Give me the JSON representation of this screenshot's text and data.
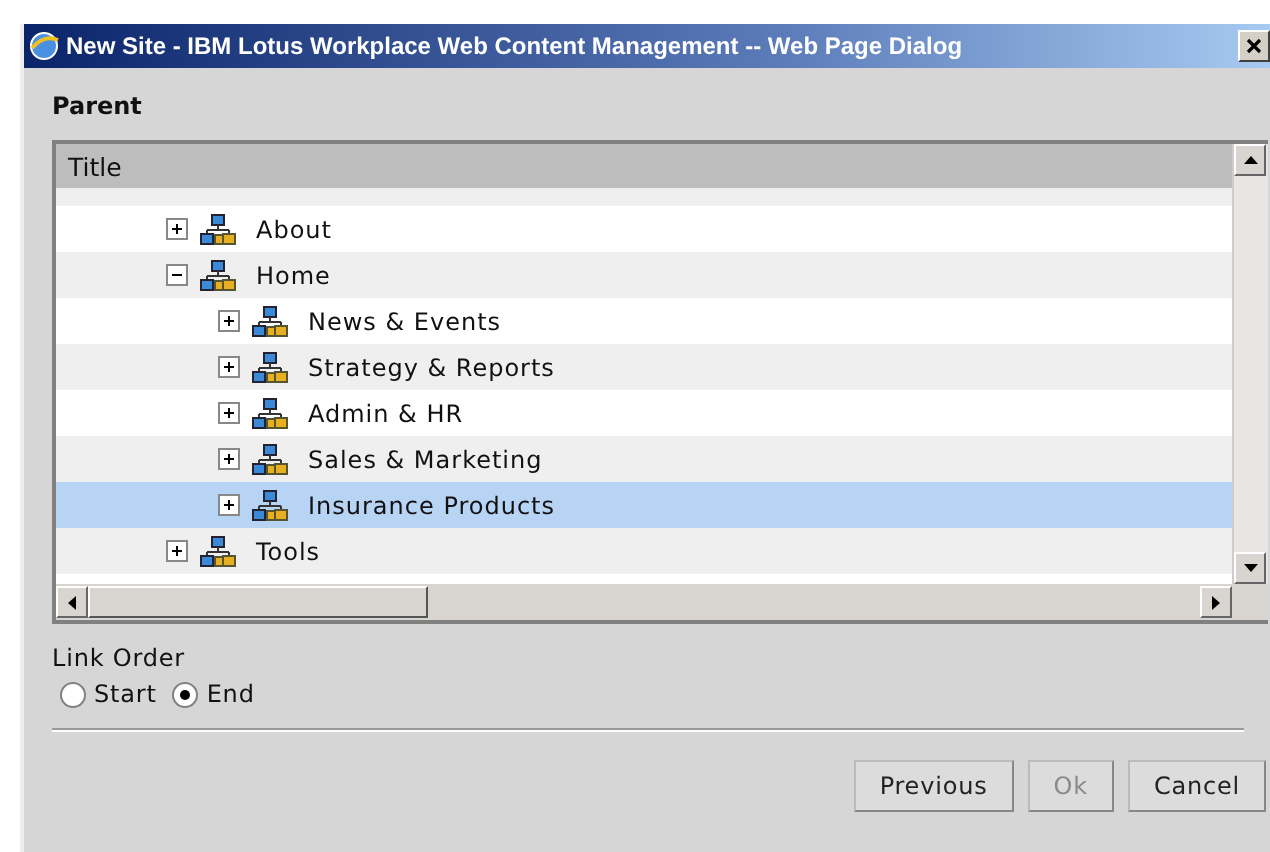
{
  "window": {
    "title": "New Site - IBM Lotus Workplace Web Content Management -- Web Page Dialog"
  },
  "parent": {
    "heading": "Parent",
    "column": "Title",
    "rows": [
      {
        "label": "About",
        "expanded": false,
        "selected": false
      },
      {
        "label": "Home",
        "expanded": true,
        "selected": false,
        "children": [
          {
            "label": "News & Events",
            "expanded": false,
            "selected": false
          },
          {
            "label": "Strategy & Reports",
            "expanded": false,
            "selected": false
          },
          {
            "label": "Admin & HR",
            "expanded": false,
            "selected": false
          },
          {
            "label": "Sales & Marketing",
            "expanded": false,
            "selected": false
          },
          {
            "label": "Insurance Products",
            "expanded": false,
            "selected": true
          }
        ]
      },
      {
        "label": "Tools",
        "expanded": false,
        "selected": false
      }
    ]
  },
  "link_order": {
    "label": "Link Order",
    "options": [
      {
        "label": "Start",
        "selected": false
      },
      {
        "label": "End",
        "selected": true
      }
    ]
  },
  "buttons": [
    {
      "label": "Previous",
      "disabled": false
    },
    {
      "label": "Ok",
      "disabled": true
    },
    {
      "label": "Cancel",
      "disabled": false
    }
  ]
}
